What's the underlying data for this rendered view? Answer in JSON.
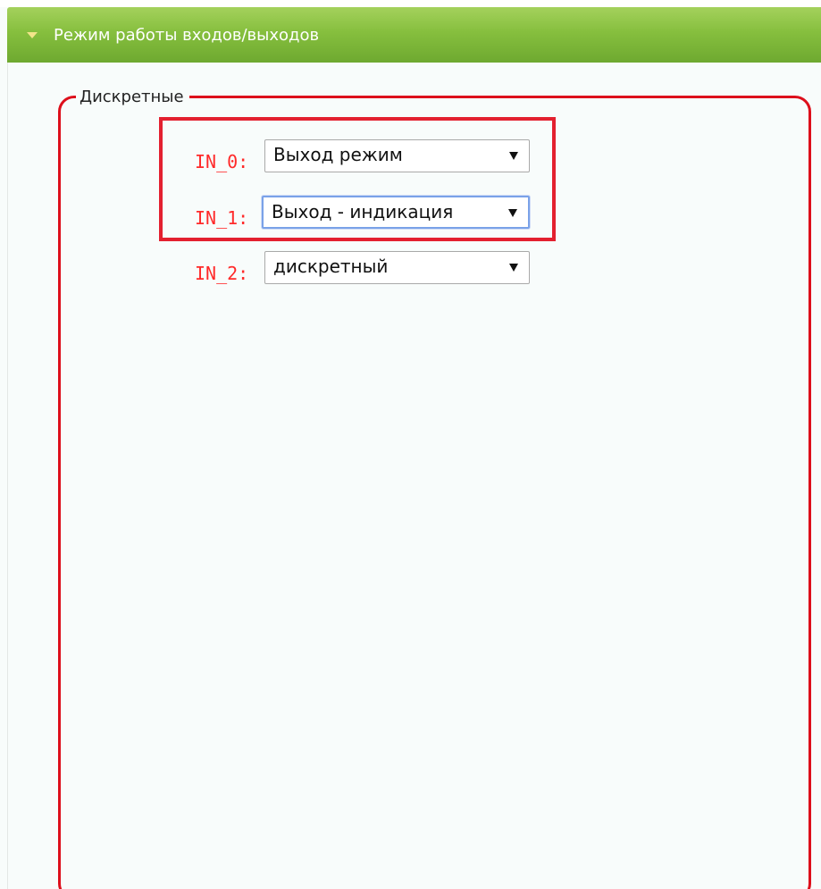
{
  "section": {
    "title": "Режим работы входов/выходов"
  },
  "fieldset": {
    "legend": "Дискретные",
    "inputs": [
      {
        "label": "IN_0:",
        "value": "Выход режим"
      },
      {
        "label": "IN_1:",
        "value": "Выход - индикация"
      },
      {
        "label": "IN_2:",
        "value": "дискретный"
      }
    ]
  },
  "colors": {
    "header_green": "#86bf3e",
    "border_red": "#dd0f1b",
    "label_red": "#ff2a2a",
    "focus_blue": "#7aa2e8"
  },
  "icons": {
    "header_toggle": "triangle-down-icon",
    "select_caret": "chevron-down-icon"
  }
}
